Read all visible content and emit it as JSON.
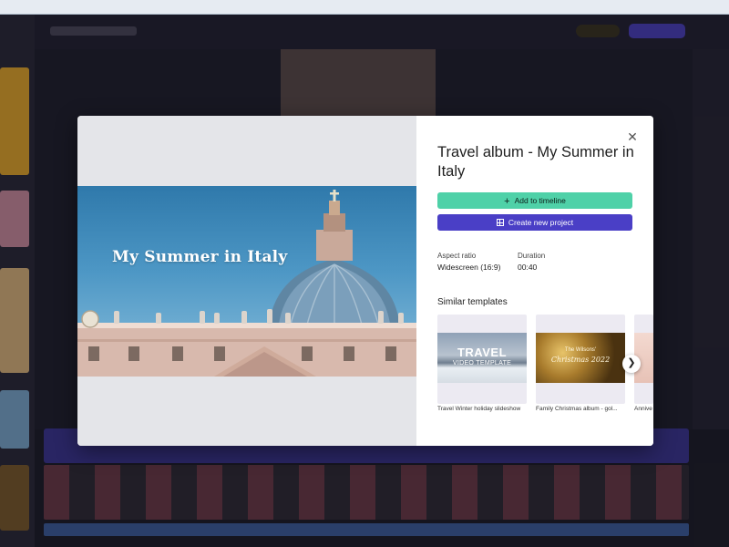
{
  "modal": {
    "title": "Travel album - My Summer in Italy",
    "preview_title": "My Summer in Italy",
    "close_icon": "close-icon",
    "buttons": {
      "add_to_timeline": "Add to timeline",
      "create_new_project": "Create new project"
    },
    "aspect_ratio": {
      "label": "Aspect ratio",
      "value": "Widescreen (16:9)"
    },
    "duration": {
      "label": "Duration",
      "value": "00:40"
    },
    "similar_heading": "Similar templates",
    "similar": [
      {
        "label": "Travel Winter holiday slideshow",
        "thumb_big": "TRAVEL",
        "thumb_small": "VIDEO TEMPLATE"
      },
      {
        "label": "Family Christmas album - gol...",
        "thumb_line1": "The Wilsons'",
        "thumb_line2": "Christmas 2022"
      },
      {
        "label": "Annive"
      }
    ],
    "colors": {
      "add_button": "#4fd1a8",
      "create_button": "#4a3fc6"
    }
  }
}
